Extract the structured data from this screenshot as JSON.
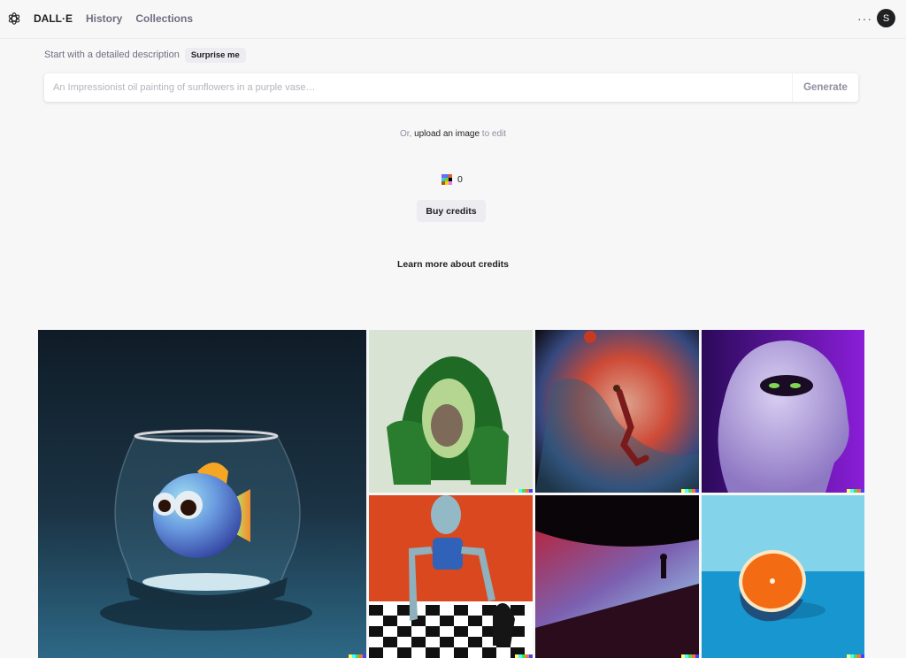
{
  "header": {
    "logo_icon": "openai-logo-icon",
    "brand": "DALL·E",
    "nav": [
      {
        "label": "History"
      },
      {
        "label": "Collections"
      }
    ],
    "more_icon": "more-horizontal-icon",
    "more_glyph": "···",
    "avatar_initial": "S"
  },
  "prompt": {
    "intro": "Start with a detailed description",
    "surprise_label": "Surprise me",
    "placeholder": "An Impressionist oil painting of sunflowers in a purple vase…",
    "value": "",
    "generate_label": "Generate"
  },
  "upload": {
    "prefix": "Or,",
    "link": "upload an image",
    "suffix": "to edit"
  },
  "credits": {
    "icon": "credits-pixel-icon",
    "count": "0",
    "buy_label": "Buy credits",
    "learn_more": "Learn more about credits",
    "icon_colors": [
      "#8a5cf5",
      "#3b82f6",
      "#f05a28",
      "#22d3ee",
      "#84cc16",
      "#000000",
      "#b45309",
      "#facc15",
      "#e879f9"
    ]
  },
  "watermark_colors": [
    "#ffff66",
    "#42ffff",
    "#51da4c",
    "#ff6e3c",
    "#3c46ff"
  ],
  "gallery": [
    {
      "name": "gallery-image-fishbowl",
      "subject": "3D render of a cute tropical fish in an aquarium on a dark blue background"
    },
    {
      "name": "gallery-image-avocado-chair",
      "subject": "An armchair in the shape of an avocado"
    },
    {
      "name": "gallery-image-basketball-nebula",
      "subject": "An expressive oil painting of a basketball player dunking, depicted as an explosion of a nebula"
    },
    {
      "name": "gallery-image-purple-monster",
      "subject": "A furry white monster with green eyes on a purple background"
    },
    {
      "name": "gallery-image-robot-chess",
      "subject": "Painting of a robot playing chess"
    },
    {
      "name": "gallery-image-light-dune",
      "subject": "A person standing on a glowing dune at night"
    },
    {
      "name": "gallery-image-orange",
      "subject": "Half an orange on a blue surface"
    }
  ]
}
